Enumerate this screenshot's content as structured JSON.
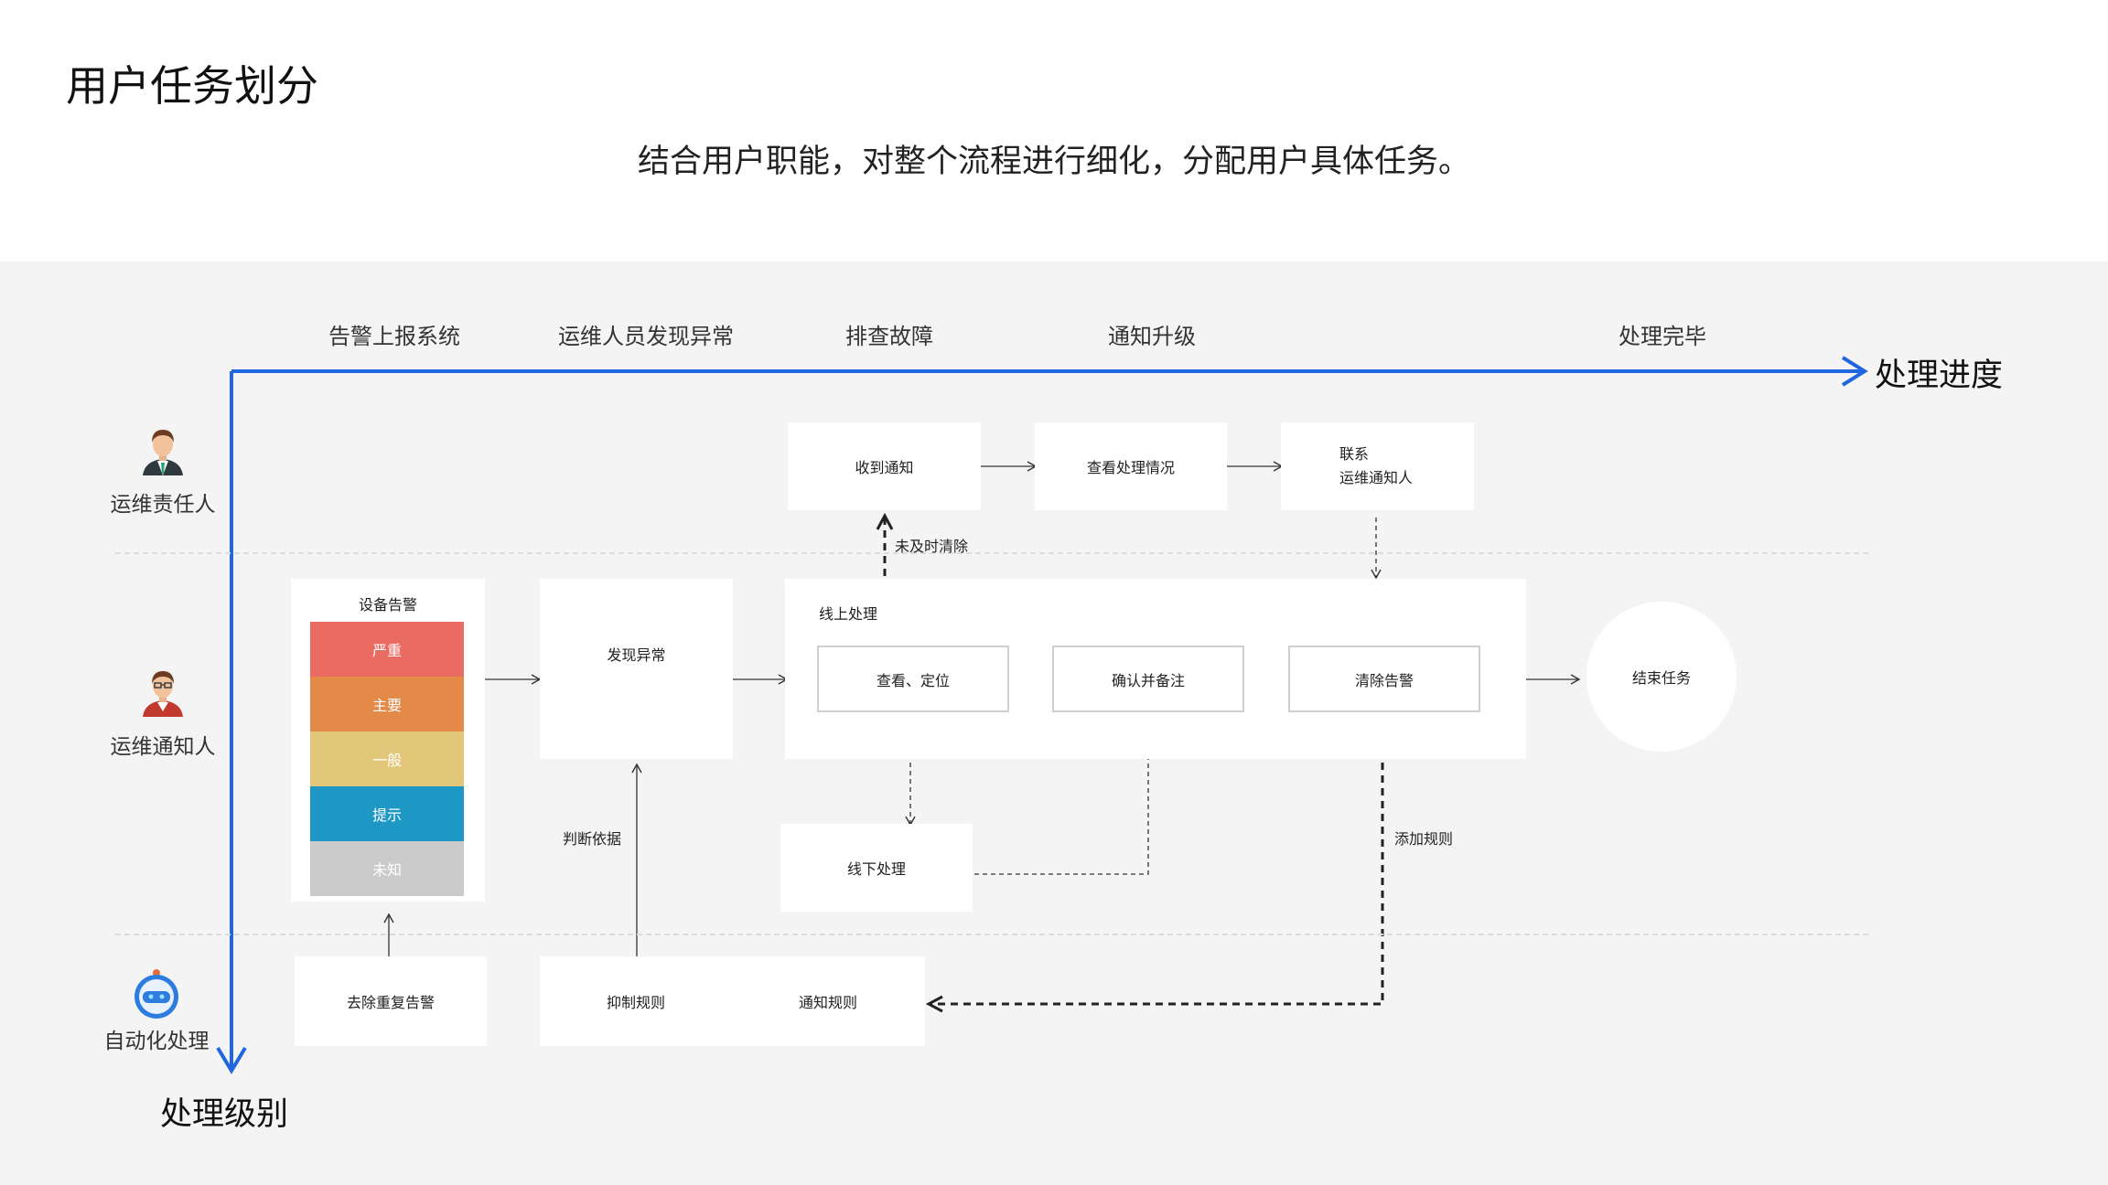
{
  "title": "用户任务划分",
  "subtitle": "结合用户职能，对整个流程进行细化，分配用户具体任务。",
  "phases": [
    "告警上报系统",
    "运维人员发现异常",
    "排查故障",
    "通知升级",
    "处理完毕"
  ],
  "axes": {
    "x_label": "处理进度",
    "y_label": "处理级别",
    "color": "#1f66e0"
  },
  "roles": [
    {
      "label": "运维责任人",
      "icon": "manager-avatar-icon"
    },
    {
      "label": "运维通知人",
      "icon": "notifier-avatar-icon"
    },
    {
      "label": "自动化处理",
      "icon": "robot-icon"
    }
  ],
  "nodes": {
    "receive_notice": "收到通知",
    "check_status": "查看处理情况",
    "contact_line1": "联系",
    "contact_line2": "运维通知人",
    "device_alarm_title": "设备告警",
    "discover_abnormal": "发现异常",
    "online_title": "线上处理",
    "view_locate": "查看、定位",
    "confirm_note": "确认并备注",
    "clear_alarm": "清除告警",
    "end_task": "结束任务",
    "offline": "线下处理",
    "dedupe_alarm": "去除重复告警",
    "suppress_rule": "抑制规则",
    "notify_rule": "通知规则"
  },
  "severity": [
    {
      "label": "严重",
      "color": "#ea6b62"
    },
    {
      "label": "主要",
      "color": "#e48a48"
    },
    {
      "label": "一般",
      "color": "#e2c77a"
    },
    {
      "label": "提示",
      "color": "#1d97c4"
    },
    {
      "label": "未知",
      "color": "#cbcbcb"
    }
  ],
  "edge_labels": {
    "not_cleared": "未及时清除",
    "basis": "判断依据",
    "add_rule": "添加规则"
  }
}
